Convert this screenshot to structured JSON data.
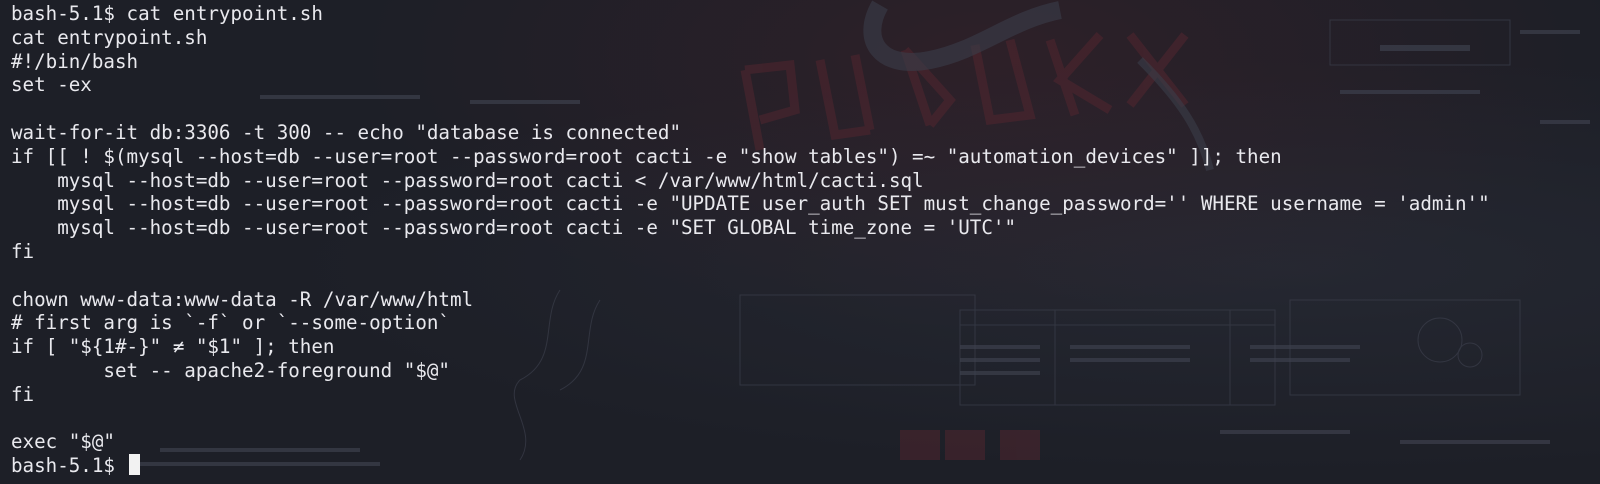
{
  "terminal": {
    "lines": [
      "bash-5.1$ cat entrypoint.sh",
      "cat entrypoint.sh",
      "#!/bin/bash",
      "set -ex",
      "",
      "wait-for-it db:3306 -t 300 -- echo \"database is connected\"",
      "if [[ ! $(mysql --host=db --user=root --password=root cacti -e \"show tables\") =~ \"automation_devices\" ]]; then",
      "    mysql --host=db --user=root --password=root cacti < /var/www/html/cacti.sql",
      "    mysql --host=db --user=root --password=root cacti -e \"UPDATE user_auth SET must_change_password='' WHERE username = 'admin'\"",
      "    mysql --host=db --user=root --password=root cacti -e \"SET GLOBAL time_zone = 'UTC'\"",
      "fi",
      "",
      "chown www-data:www-data -R /var/www/html",
      "# first arg is `-f` or `--some-option`",
      "if [ \"${1#-}\" ≠ \"$1\" ]; then",
      "        set -- apache2-foreground \"$@\"",
      "fi",
      "",
      "exec \"$@\""
    ],
    "prompt": "bash-5.1$ "
  }
}
